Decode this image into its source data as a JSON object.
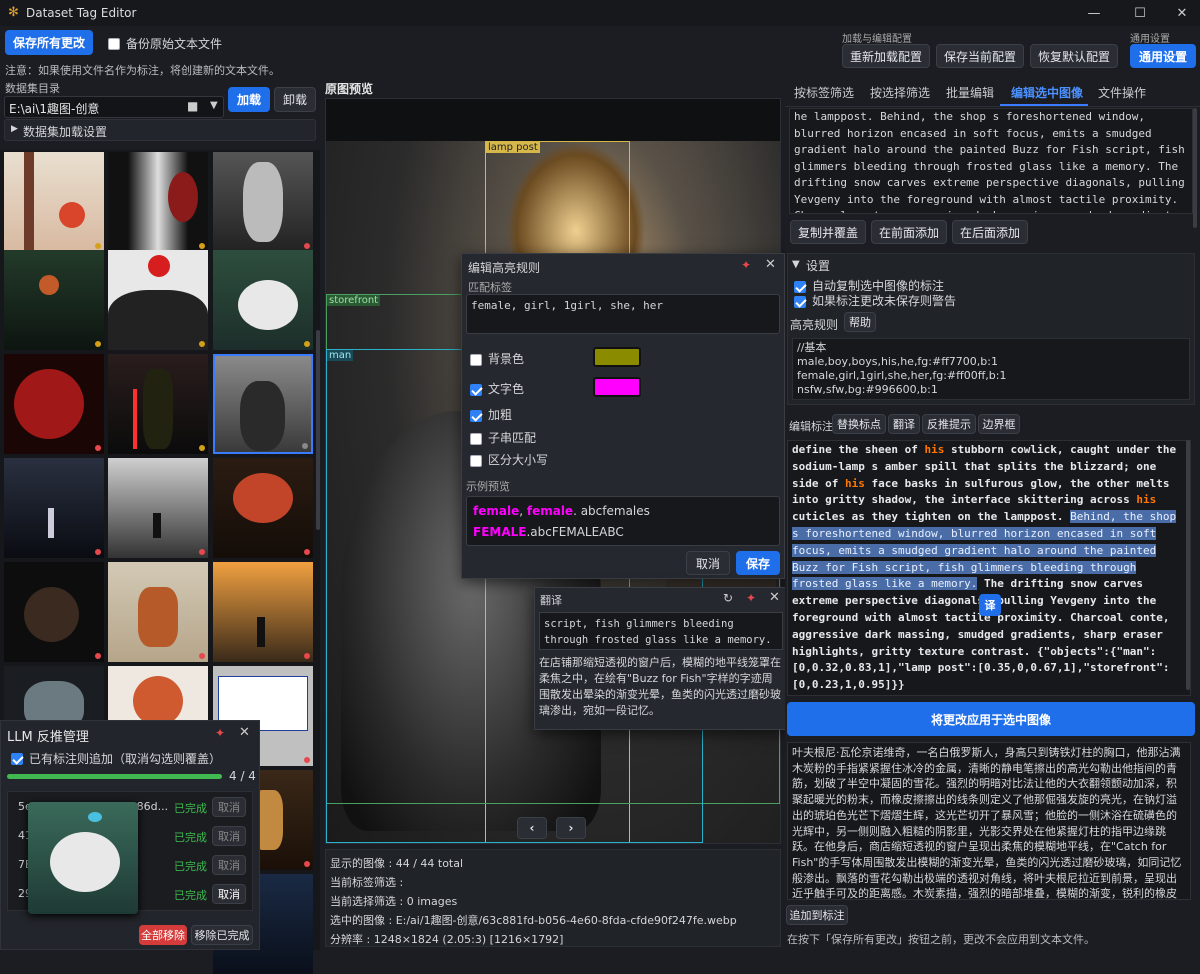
{
  "window": {
    "title": "Dataset Tag Editor"
  },
  "toolbar": {
    "save_all": "保存所有更改",
    "backup_label": "备份原始文本文件",
    "note": "注意：如果使用文件名作为标注，将创建新的文本文件。",
    "config_group": "加载与编辑配置",
    "reload_config": "重新加载配置",
    "save_config": "保存当前配置",
    "restore_default": "恢复默认配置",
    "general_group": "通用设置",
    "apply_settings": "通用设置"
  },
  "dataset": {
    "dir_label": "数据集目录",
    "dir_value": "E:\\ai\\1趣图-创意",
    "load": "加载",
    "unload": "卸载",
    "load_settings": "数据集加载设置"
  },
  "preview": {
    "title": "原图预览",
    "boxes": [
      "lamp post",
      "storefront",
      "man"
    ],
    "prev": "‹",
    "next": "›",
    "shown": "显示的图像 : 44 / 44 total",
    "tag_filter": "当前标签筛选 :",
    "sel_filter": "当前选择筛选 : 0 images",
    "selected": "选中的图像 : E:/ai/1趣图-创意/63c881fd-b056-4e60-8fda-cfde90f247fe.webp",
    "resolution": "分辨率 : 1248×1824 (2.05:3) [1216×1792]"
  },
  "highlight_dialog": {
    "title": "编辑高亮规则",
    "match_label": "匹配标签",
    "match_value": "female, girl, 1girl, she, her",
    "bg_label": "背景色",
    "fg_label": "文字色",
    "bold_label": "加粗",
    "substr_label": "子串匹配",
    "case_label": "区分大小写",
    "preview_label": "示例预览",
    "ex1a": "female",
    "ex1b": ", ",
    "ex1c": "female",
    "ex1d": ". abcfemales",
    "ex2a": "FEMALE",
    "ex2b": ".abcFEMALEABC",
    "cancel": "取消",
    "save": "保存",
    "bg_color": "#8b8b00",
    "fg_color": "#ff00ff"
  },
  "translate_dialog": {
    "title": "翻译",
    "source": "script, fish glimmers bleeding through frosted glass like a memory.",
    "result": "在店铺那缩短透视的窗户后，模糊的地平线笼罩在柔焦之中，在绘有\"Buzz for Fish\"字样的字迹周围散发出晕染的渐变光晕，鱼类的闪光透过磨砂玻璃渗出，宛如一段记忆。"
  },
  "llm": {
    "title": "LLM 反推管理",
    "append_label": "已有标注则追加（取消勾选则覆盖）",
    "progress": "4 / 4",
    "progress_value": 1.0,
    "rows": [
      {
        "id": "5e73c12d-fcd0-4446-86d...",
        "status": "已完成",
        "action": "取消"
      },
      {
        "id": "41...",
        "status": "已完成",
        "action": "取消"
      },
      {
        "id": "7E...",
        "status": "已完成",
        "action": "取消"
      },
      {
        "id": "29...",
        "status": "已完成",
        "action": "取消"
      }
    ],
    "remove_all": "全部移除",
    "remove_done": "移除已完成"
  },
  "tabs": [
    "按标签筛选",
    "按选择筛选",
    "批量编辑",
    "编辑选中图像",
    "文件操作"
  ],
  "active_tab": 3,
  "editor": {
    "top_text": "he lamppost. Behind, the shop s foreshortened window, blurred horizon encased in soft focus, emits a smudged gradient halo around the painted  Buzz for Fish  script, fish glimmers bleeding through frosted glass like a memory. The drifting snow carves extreme perspective diagonals, pulling Yevgeny into the foreground with almost tactile proximity. Charcoal conte, aggressive dark massing, smudged gradients, sharp eraser highlights, gritty texture contrast",
    "copy_overwrite": "复制并覆盖",
    "prepend": "在前面添加",
    "append": "在后面添加",
    "settings": "设置",
    "auto_copy": "自动复制选中图像的标注",
    "warn_unsaved": "如果标注更改未保存则警告",
    "highlight_rules": "高亮规则",
    "help": "帮助",
    "rules": "//基本\nmale,boy,boys,his,he,fg:#ff7700,b:1\nfemale,girl,1girl,she,her,fg:#ff00ff,b:1\nnsfw,sfw,bg:#996600,b:1",
    "edit_label": "编辑标注",
    "replace_punct": "替换标点",
    "translate": "翻译",
    "reverse_prompt": "反推提示",
    "bbox": "边界框",
    "cap_a": "define the sheen of ",
    "cap_his1": "his",
    "cap_b": " stubborn cowlick, caught under the sodium-lamp s amber spill that splits the blizzard; one side of ",
    "cap_his2": "his",
    "cap_c": " face basks in sulfurous glow, the other melts into gritty shadow, the interface skittering across ",
    "cap_his3": "his",
    "cap_d": " cuticles as they tighten on the lamppost. ",
    "cap_sel": "Behind, the shop s foreshortened window, blurred horizon encased in soft focus, emits a smudged gradient halo around the painted  Buzz for Fish  script, fish glimmers bleeding through frosted glass like a memory.",
    "cap_e": " The drifting snow carves extreme perspective diagonals, pulling Yevgeny into the foreground with almost tactile proximity. Charcoal conte, aggressive dark massing, smudged gradients, sharp eraser highlights, gritty texture contrast.",
    "cap_json": " {\"objects\":{\"man\":[0,0.32,0.83,1],\"lamp post\":[0.35,0,0.67,1],\"storefront\":[0,0.23,1,0.95]}}",
    "translate_badge": "译",
    "apply": "将更改应用于选中图像",
    "translation": "叶夫根尼·瓦伦京诺维奇，一名白俄罗斯人，身高只到铸铁灯柱的胸口，他那沾满木炭粉的手指紧紧握住冰冷的金属，清晰的静电笔擦出的高光勾勒出他指间的青筋，划破了半空中凝固的雪花。强烈的明暗对比法让他的大衣翻领颤动加深，积聚起暖光的粉末，而橡皮擦擦出的线条则定义了他那倔强发旋的亮光，在钠灯溢出的琥珀色光芒下熠熠生辉，这光芒切开了暴风雪；他脸的一侧沐浴在硫磺色的光辉中，另一侧则融入粗糙的阴影里，光影交界处在他紧握灯柱的指甲边缘跳跃。在他身后，商店缩短透视的窗户呈现出柔焦的模糊地平线，在\"Catch for Fish\"的手写体周围散发出模糊的渐变光晕，鱼类的闪光透过磨砂玻璃，如同记忆般渗出。飘落的雪花勾勒出极端的透视对角线，将叶夫根尼拉近到前景，呈现出近乎触手可及的距离感。木炭素描，强烈的暗部堆叠，模糊的渐变，锐利的橡皮高光，粗糙的纹理对比。",
    "add_to_caption": "追加到标注",
    "footer": "在按下「保存所有更改」按钮之前，更改不会应用到文本文件。"
  },
  "colors": {
    "accent": "#1f6feb",
    "done": "#3fb950",
    "red_dot": "#e5484d",
    "yellow_dot": "#d4a017"
  }
}
